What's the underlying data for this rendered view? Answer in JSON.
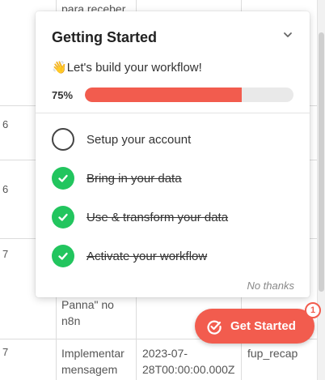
{
  "table": {
    "row_numbers": [
      "6",
      "6",
      "7",
      "7"
    ],
    "cells": {
      "top_text": "para receber",
      "panna_line1": "Panna\" no",
      "panna_line2": "n8n",
      "impl_line1": "Implementar",
      "impl_line2": "mensagem",
      "date_line1": "2023-07-",
      "date_line2": "28T00:00:00.000Z",
      "recap": "fup_recap"
    }
  },
  "card": {
    "title": "Getting Started",
    "subtitle_emoji": "👋",
    "subtitle": "Let's build your workflow!",
    "progress_label": "75%",
    "progress_fraction": 0.75,
    "tasks": [
      {
        "label": "Setup your account",
        "done": false
      },
      {
        "label": "Bring in your data",
        "done": true
      },
      {
        "label": "Use & transform your data",
        "done": true
      },
      {
        "label": "Activate your workflow",
        "done": true
      }
    ],
    "no_thanks": "No thanks"
  },
  "floating_button": {
    "label": "Get Started",
    "badge": "1"
  },
  "colors": {
    "accent": "#f25c4e",
    "done_green": "#22c55e"
  }
}
